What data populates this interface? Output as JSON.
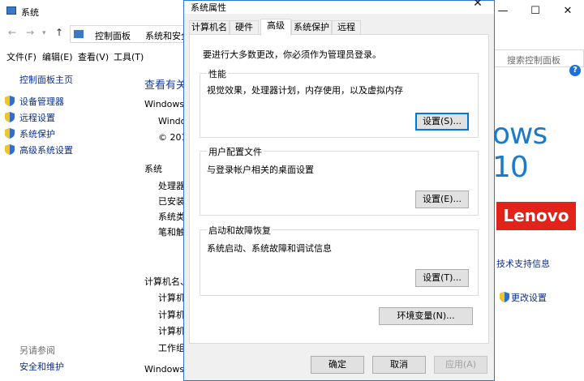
{
  "background_window": {
    "title": "系统",
    "controls": {
      "minimize": "—",
      "maximize": "☐",
      "close": "✕"
    },
    "breadcrumbs": [
      "控制面板",
      "系统和安全"
    ],
    "search_placeholder": "搜索控制面板",
    "menu": [
      "文件(F)",
      "编辑(E)",
      "查看(V)",
      "工具(T)"
    ],
    "sidebar": {
      "home": "控制面板主页",
      "items": [
        "设备管理器",
        "远程设置",
        "系统保护",
        "高级系统设置"
      ],
      "see_also": "另请参阅",
      "security": "安全和维护"
    },
    "main": {
      "heading": "查看有关",
      "edition_label": "Windows",
      "win_line": "Windo",
      "copyright": "© 201",
      "system_label": "系统",
      "rows": [
        "处理器:",
        "已安装",
        "系统类",
        "笔和触"
      ],
      "computer_label": "计算机名、",
      "computer_rows": [
        "计算机",
        "计算机",
        "计算机",
        "工作组"
      ],
      "activation_label": "Windows"
    },
    "brand": {
      "win10_text": "ows 10",
      "lenovo_text": "Lenovo",
      "support_link": "技术支持信息",
      "change_settings": "更改设置"
    }
  },
  "dialog": {
    "title": "系统属性",
    "close": "✕",
    "tabs": [
      "计算机名",
      "硬件",
      "高级",
      "系统保护",
      "远程"
    ],
    "active_tab": "高级",
    "admin_note": "要进行大多数更改，你必须作为管理员登录。",
    "groups": [
      {
        "title": "性能",
        "description": "视觉效果，处理器计划，内存使用，以及虚拟内存",
        "button": "设置(S)..."
      },
      {
        "title": "用户配置文件",
        "description": "与登录帐户相关的桌面设置",
        "button": "设置(E)..."
      },
      {
        "title": "启动和故障恢复",
        "description": "系统启动、系统故障和调试信息",
        "button": "设置(T)..."
      }
    ],
    "env_button": "环境变量(N)...",
    "ok": "确定",
    "cancel": "取消",
    "apply": "应用(A)"
  }
}
